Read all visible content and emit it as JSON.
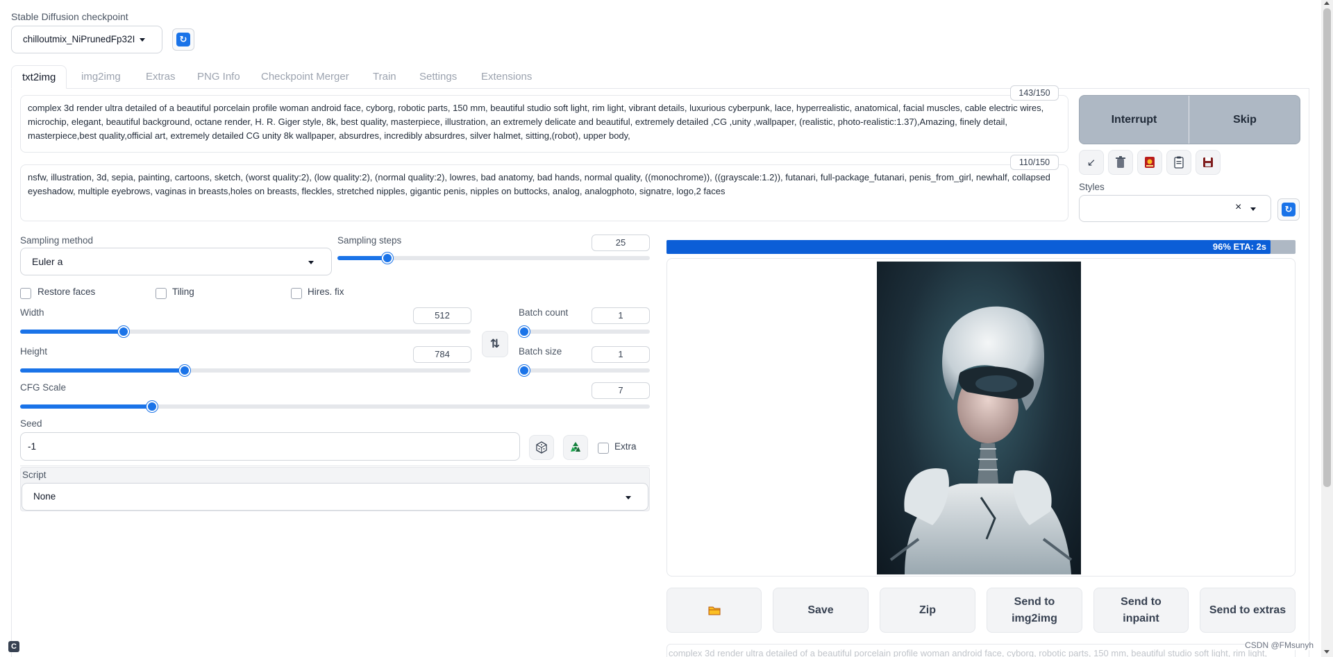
{
  "checkpoint": {
    "label": "Stable Diffusion checkpoint",
    "value": "chilloutmix_NiPrunedFp32I",
    "refresh_icon": "refresh-icon"
  },
  "tabs": [
    {
      "label": "txt2img",
      "active": true
    },
    {
      "label": "img2img"
    },
    {
      "label": "Extras"
    },
    {
      "label": "PNG Info"
    },
    {
      "label": "Checkpoint Merger"
    },
    {
      "label": "Train"
    },
    {
      "label": "Settings"
    },
    {
      "label": "Extensions"
    }
  ],
  "prompt": {
    "counter": "143/150",
    "text": "complex 3d render ultra detailed of a beautiful porcelain profile woman android face, cyborg, robotic parts, 150 mm, beautiful studio soft light, rim light, vibrant details, luxurious cyberpunk, lace, hyperrealistic, anatomical, facial muscles, cable electric wires, microchip, elegant, beautiful background, octane render, H. R. Giger style, 8k, best quality, masterpiece, illustration, an extremely delicate and beautiful, extremely detailed ,CG ,unity ,wallpaper, (realistic, photo-realistic:1.37),Amazing, finely detail, masterpiece,best quality,official art, extremely detailed CG unity 8k wallpaper, absurdres, incredibly absurdres, silver halmet, sitting,(robot), upper body,"
  },
  "negative_prompt": {
    "counter": "110/150",
    "text": "nsfw, illustration, 3d, sepia, painting, cartoons, sketch, (worst quality:2), (low quality:2), (normal quality:2), lowres, bad anatomy, bad hands, normal quality, ((monochrome)), ((grayscale:1.2)), futanari, full-package_futanari, penis_from_girl, newhalf, collapsed eyeshadow, multiple eyebrows, vaginas in breasts,holes on breasts, fleckles, stretched nipples, gigantic penis, nipples on buttocks, analog, analogphoto, signatre, logo,2 faces"
  },
  "generate": {
    "interrupt": "Interrupt",
    "skip": "Skip"
  },
  "tools": {
    "icons": [
      "arrow-icon",
      "trash-icon",
      "red-card-icon",
      "clipboard-icon",
      "save-icon"
    ]
  },
  "styles": {
    "label": "Styles",
    "clear": "×"
  },
  "sampling": {
    "method_label": "Sampling method",
    "method_value": "Euler a",
    "steps_label": "Sampling steps",
    "steps_value": "25",
    "steps_fraction": 0.16
  },
  "checkboxes": {
    "restore_faces": "Restore faces",
    "tiling": "Tiling",
    "hires_fix": "Hires. fix"
  },
  "size": {
    "width_label": "Width",
    "width_value": "512",
    "width_fraction": 0.23,
    "height_label": "Height",
    "height_value": "784",
    "height_fraction": 0.365,
    "swap_icon": "⇅"
  },
  "batch": {
    "count_label": "Batch count",
    "count_value": "1",
    "size_label": "Batch size",
    "size_value": "1"
  },
  "cfg": {
    "label": "CFG Scale",
    "value": "7",
    "fraction": 0.21
  },
  "seed": {
    "label": "Seed",
    "value": "-1",
    "extra_label": "Extra"
  },
  "script": {
    "label": "Script",
    "value": "None"
  },
  "progress": {
    "text": "96% ETA: 2s",
    "fraction": 0.96
  },
  "result_buttons": {
    "folder_icon": "folder-icon",
    "save": "Save",
    "zip": "Zip",
    "send_img2img": "Send to img2img",
    "send_inpaint": "Send to inpaint",
    "send_extras": "Send to extras"
  },
  "info_text": "complex 3d render ultra detailed of a beautiful porcelain profile woman android face, cyborg, robotic parts, 150 mm, beautiful studio soft light, rim light,",
  "watermark": "CSDN @FMsunyh",
  "colors": {
    "accent": "#1a73e8",
    "progress_bg": "#0b5ed7"
  }
}
